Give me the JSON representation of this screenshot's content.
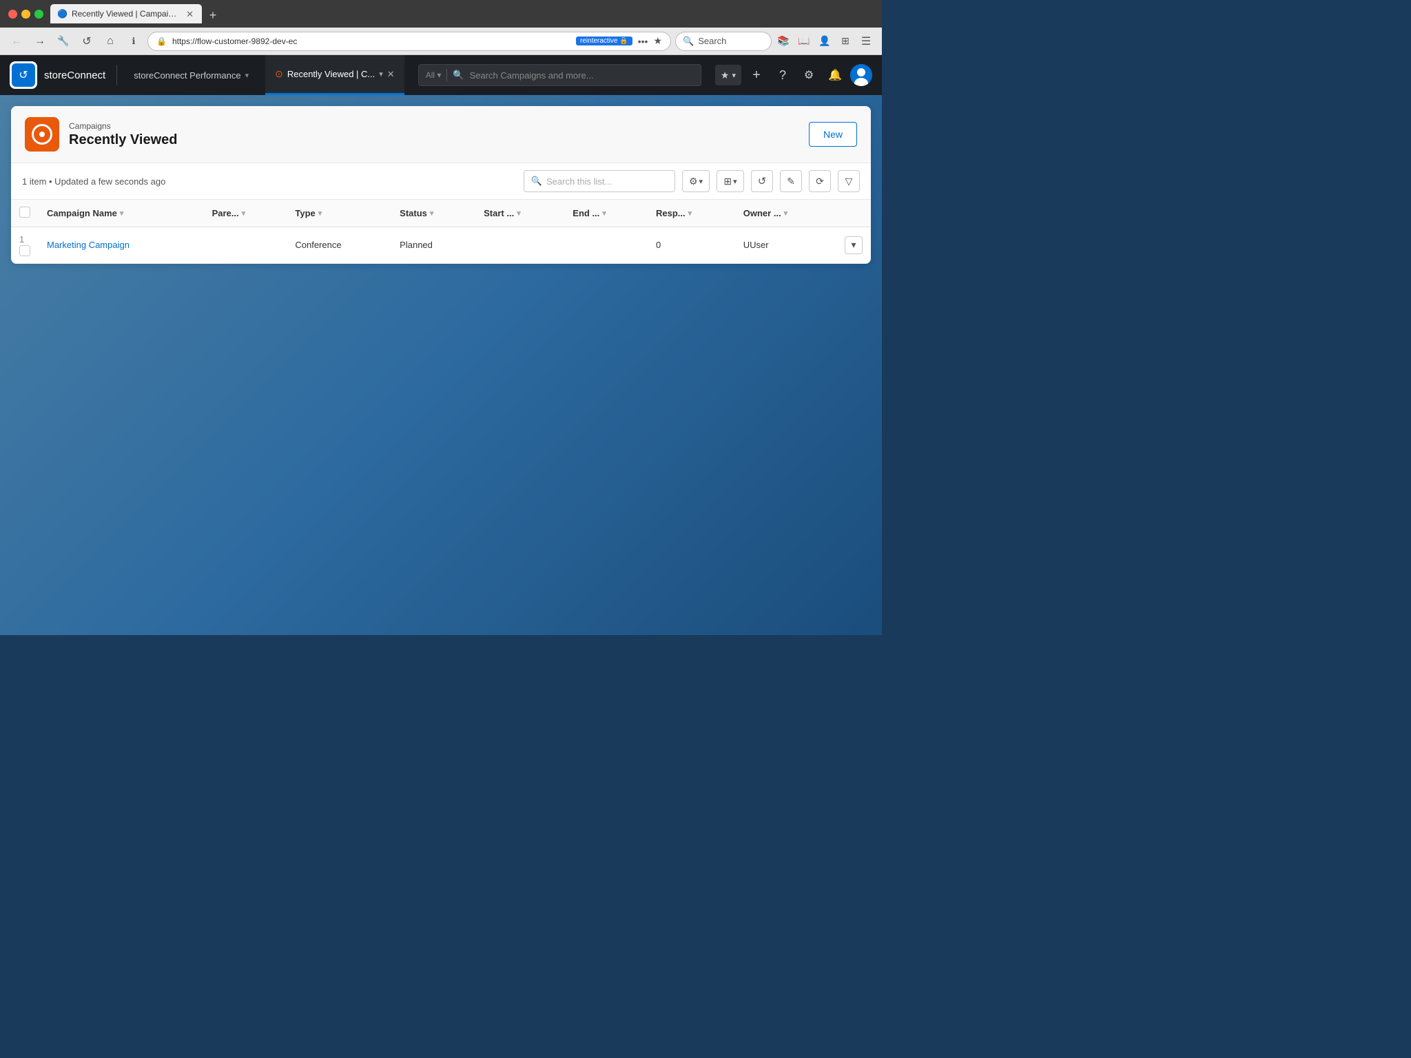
{
  "browser": {
    "tabs": [
      {
        "id": "tab1",
        "title": "Recently Viewed | Campaigns |",
        "favicon": "🔵",
        "active": true
      }
    ],
    "new_tab_label": "+",
    "toolbar": {
      "url": "https://flow-customer-9892-dev-ec",
      "url_badge": "reinteractive 🔒",
      "more_label": "•••",
      "search_placeholder": "Search"
    },
    "nav": {
      "back_label": "←",
      "forward_label": "→",
      "tools_label": "🔧",
      "reload_label": "↺",
      "home_label": "⌂",
      "info_label": "ℹ"
    }
  },
  "salesforce": {
    "logo_icon": "↺",
    "app_name": "storeConnect",
    "nav_tabs": [
      {
        "label": "storeConnect Performance",
        "active": false
      },
      {
        "label": "Recently Viewed | C...",
        "active": true
      }
    ],
    "search": {
      "all_label": "All",
      "placeholder": "Search Campaigns and more..."
    },
    "topnav_icons": {
      "favorites": "★",
      "add": "+",
      "help": "?",
      "setup": "⚙",
      "bell": "🔔"
    }
  },
  "campaigns": {
    "breadcrumb": "Campaigns",
    "title": "Recently Viewed",
    "new_button_label": "New",
    "list_info": "1 item • Updated a few seconds ago",
    "search_placeholder": "Search this list...",
    "columns": [
      {
        "id": "name",
        "label": "Campaign Name",
        "sortable": true
      },
      {
        "id": "parent",
        "label": "Pare...",
        "sortable": true
      },
      {
        "id": "type",
        "label": "Type",
        "sortable": true
      },
      {
        "id": "status",
        "label": "Status",
        "sortable": true
      },
      {
        "id": "start",
        "label": "Start ...",
        "sortable": true
      },
      {
        "id": "end",
        "label": "End ...",
        "sortable": true
      },
      {
        "id": "resp",
        "label": "Resp...",
        "sortable": true
      },
      {
        "id": "owner",
        "label": "Owner ...",
        "sortable": true
      }
    ],
    "rows": [
      {
        "num": "1",
        "name": "Marketing Campaign",
        "parent": "",
        "type": "Conference",
        "status": "Planned",
        "start": "",
        "end": "",
        "resp": "0",
        "owner": "UUser"
      }
    ]
  }
}
